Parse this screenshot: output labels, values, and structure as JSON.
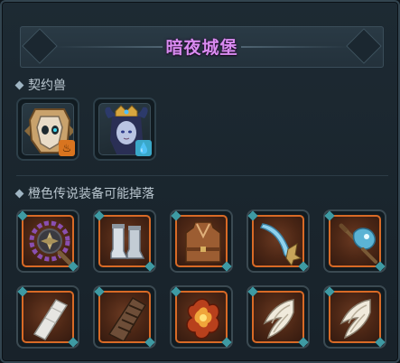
{
  "title": "暗夜城堡",
  "colors": {
    "title": "#d98bf0",
    "legendary_frame": "#d86a26",
    "panel_bg": "#1d2a33"
  },
  "pets_section": {
    "label": "契约兽",
    "pets": [
      {
        "name_icon": "skull-mask-pet-portrait",
        "element_icon": "fire-element-icon"
      },
      {
        "name_icon": "horned-sorceress-pet-portrait",
        "element_icon": "water-element-icon"
      }
    ]
  },
  "drops_section": {
    "label": "橙色传说装备可能掉落",
    "items": [
      {
        "icon": "spiked-ring-shield-icon"
      },
      {
        "icon": "steel-greaves-icon"
      },
      {
        "icon": "leather-tunic-icon"
      },
      {
        "icon": "ice-crescent-blade-icon"
      },
      {
        "icon": "frost-bird-wand-icon"
      },
      {
        "icon": "cloth-bracer-icon"
      },
      {
        "icon": "wrapped-bandage-bracer-icon"
      },
      {
        "icon": "flame-amulet-icon"
      },
      {
        "icon": "winged-boots-icon"
      },
      {
        "icon": "winged-boots-icon"
      }
    ]
  }
}
